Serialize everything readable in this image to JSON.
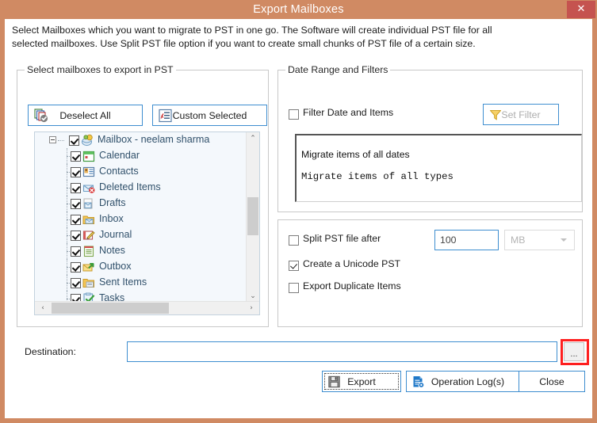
{
  "window": {
    "title": "Export Mailboxes",
    "close_label": "✕",
    "accent_color": "#d08a63",
    "close_color": "#c5534f"
  },
  "intro": {
    "text": "Select Mailboxes which you want to migrate to PST in one go. The Software will create individual PST file for all selected mailboxes. Use Split PST file option if you want to create small chunks of PST file of a certain size."
  },
  "mailboxes_group": {
    "title": "Select mailboxes to export in PST",
    "deselect_all_label": "Deselect All",
    "custom_selected_label": "Custom Selected",
    "tree": {
      "root": {
        "label": "Mailbox - neelam sharma",
        "checked": true,
        "expanded": true,
        "icon": "mailbox-icon"
      },
      "children": [
        {
          "label": "Calendar",
          "checked": true,
          "icon": "calendar-icon"
        },
        {
          "label": "Contacts",
          "checked": true,
          "icon": "contacts-icon"
        },
        {
          "label": "Deleted Items",
          "checked": true,
          "icon": "deleted-items-icon"
        },
        {
          "label": "Drafts",
          "checked": true,
          "icon": "drafts-icon"
        },
        {
          "label": "Inbox",
          "checked": true,
          "icon": "inbox-icon"
        },
        {
          "label": "Journal",
          "checked": true,
          "icon": "journal-icon"
        },
        {
          "label": "Notes",
          "checked": true,
          "icon": "notes-icon"
        },
        {
          "label": "Outbox",
          "checked": true,
          "icon": "outbox-icon"
        },
        {
          "label": "Sent Items",
          "checked": true,
          "icon": "sent-items-icon"
        },
        {
          "label": "Tasks",
          "checked": true,
          "icon": "tasks-icon"
        }
      ]
    },
    "scroll": {
      "up": "⌃",
      "down": "⌄",
      "left": "‹",
      "right": "›"
    }
  },
  "date_range_group": {
    "title": "Date Range and Filters",
    "filter_checkbox_label": "Filter Date and Items",
    "filter_checked": false,
    "set_filter_label": "Set Filter",
    "set_filter_enabled": false,
    "summary_line_1": "Migrate items of all dates",
    "summary_line_2": "Migrate items of all types"
  },
  "options_group": {
    "split_label": "Split PST file after",
    "split_checked": false,
    "split_size_value": "100",
    "split_unit_value": "MB",
    "unicode_label": "Create a Unicode PST",
    "unicode_checked": true,
    "duplicate_label": "Export Duplicate Items",
    "duplicate_checked": false
  },
  "destination": {
    "label": "Destination:",
    "value": "",
    "browse_label": "...",
    "browse_highlight_color": "#fe1f1f"
  },
  "footer": {
    "export_label": "Export",
    "operation_logs_label": "Operation Log(s)",
    "close_label": "Close"
  }
}
